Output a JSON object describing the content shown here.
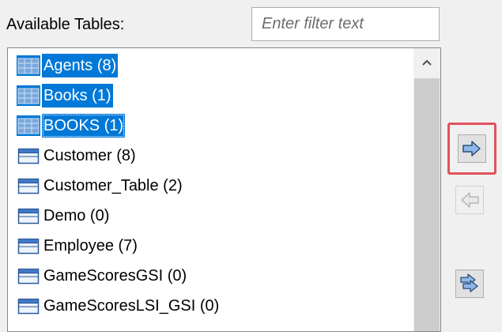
{
  "available_tables": {
    "label": "Available Tables:",
    "filter_placeholder": "Enter filter text",
    "filter_value": "",
    "items": [
      {
        "label": "Agents (8)",
        "selected": true,
        "focused": false
      },
      {
        "label": "Books (1)",
        "selected": true,
        "focused": false
      },
      {
        "label": "BOOKS (1)",
        "selected": true,
        "focused": true
      },
      {
        "label": "Customer (8)",
        "selected": false,
        "focused": false
      },
      {
        "label": "Customer_Table (2)",
        "selected": false,
        "focused": false
      },
      {
        "label": "Demo (0)",
        "selected": false,
        "focused": false
      },
      {
        "label": "Employee (7)",
        "selected": false,
        "focused": false
      },
      {
        "label": "GameScoresGSI (0)",
        "selected": false,
        "focused": false
      },
      {
        "label": "GameScoresLSI_GSI (0)",
        "selected": false,
        "focused": false
      }
    ]
  },
  "buttons": {
    "add_selected_icon": "arrow-right-icon",
    "remove_selected_icon": "arrow-left-icon",
    "add_all_icon": "double-arrow-right-icon"
  },
  "colors": {
    "selection": "#0078d7",
    "highlight_border": "#e0525c",
    "arrow_fill": "#8fb8e8"
  }
}
